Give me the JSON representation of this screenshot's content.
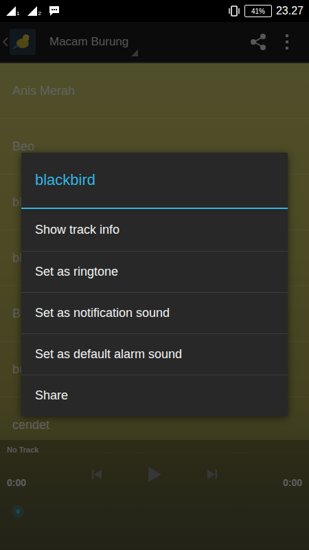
{
  "status_bar": {
    "sim1": "1",
    "sim2": "2",
    "battery": "41%",
    "time": "23.27"
  },
  "action_bar": {
    "title": "Macam Burung"
  },
  "list": {
    "items": [
      "Anis Merah",
      "Beo",
      "bl",
      "bl",
      "B",
      "bu",
      "cendet"
    ]
  },
  "player": {
    "track": "No Track",
    "elapsed": "0:00",
    "total": "0:00"
  },
  "dialog": {
    "title": "blackbird",
    "items": [
      "Show track info",
      "Set as ringtone",
      "Set as notification sound",
      "Set as default alarm sound",
      "Share"
    ]
  }
}
